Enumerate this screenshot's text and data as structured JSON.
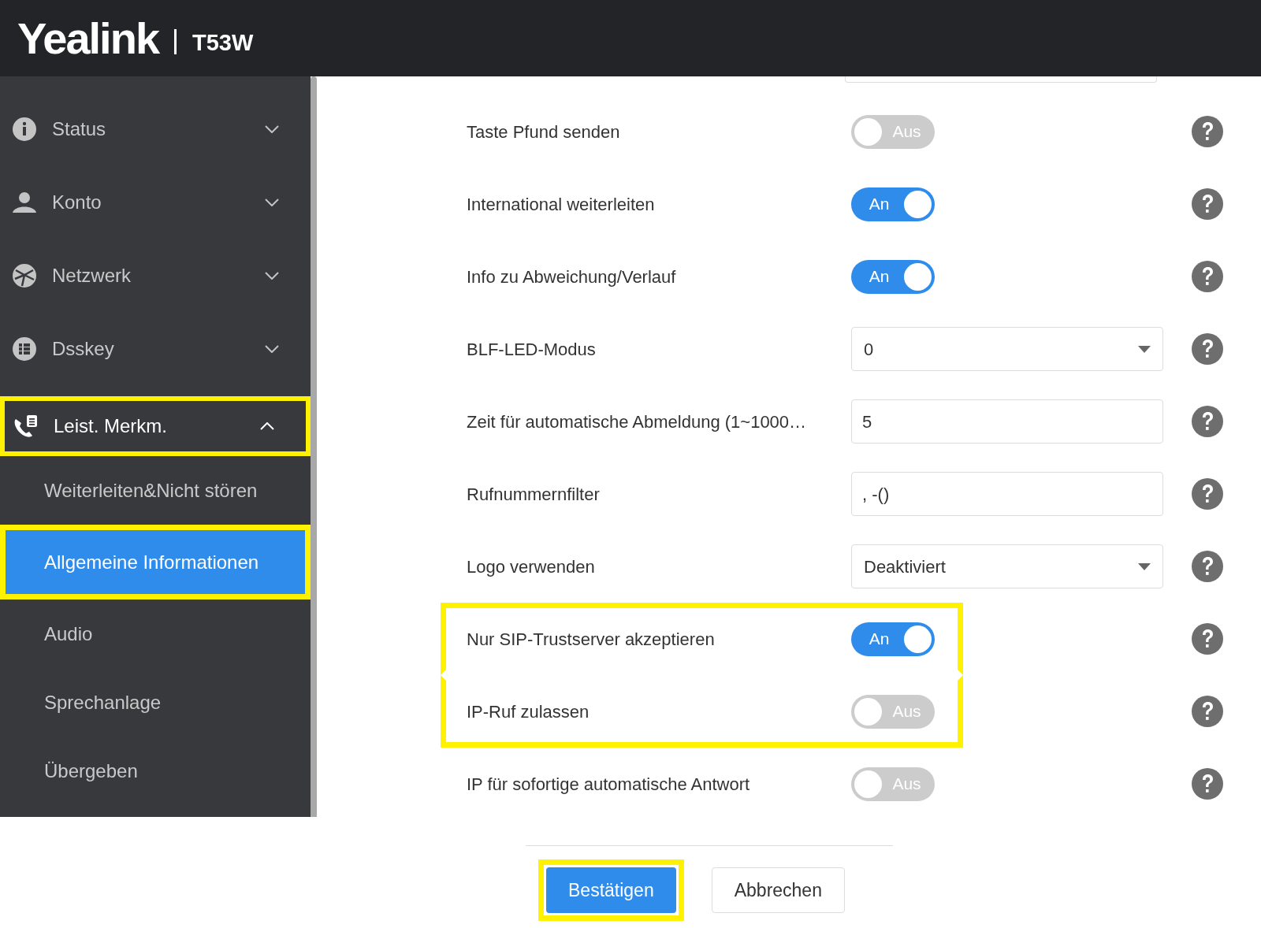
{
  "header": {
    "logo": "Yealink",
    "model": "T53W"
  },
  "sidebar": {
    "items": [
      {
        "label": "Status",
        "expanded": false,
        "highlighted": false
      },
      {
        "label": "Konto",
        "expanded": false,
        "highlighted": false
      },
      {
        "label": "Netzwerk",
        "expanded": false,
        "highlighted": false
      },
      {
        "label": "Dsskey",
        "expanded": false,
        "highlighted": false
      },
      {
        "label": "Leist. Merkm.",
        "expanded": true,
        "highlighted": true,
        "children": [
          {
            "label": "Weiterleiten&Nicht stören",
            "selected": false,
            "highlighted": false
          },
          {
            "label": "Allgemeine Informationen",
            "selected": true,
            "highlighted": true
          },
          {
            "label": "Audio",
            "selected": false,
            "highlighted": false
          },
          {
            "label": "Sprechanlage",
            "selected": false,
            "highlighted": false
          },
          {
            "label": "Übergeben",
            "selected": false,
            "highlighted": false
          }
        ]
      }
    ]
  },
  "settings": [
    {
      "label": "Taste Pfund senden",
      "kind": "toggle",
      "on": false,
      "value": "Aus",
      "highlighted": false
    },
    {
      "label": "International weiterleiten",
      "kind": "toggle",
      "on": true,
      "value": "An",
      "highlighted": false
    },
    {
      "label": "Info zu Abweichung/Verlauf",
      "kind": "toggle",
      "on": true,
      "value": "An",
      "highlighted": false
    },
    {
      "label": "BLF-LED-Modus",
      "kind": "select",
      "value": "0",
      "highlighted": false
    },
    {
      "label": "Zeit für automatische Abmeldung (1~1000…",
      "kind": "text",
      "value": "5",
      "highlighted": false
    },
    {
      "label": "Rufnummernfilter",
      "kind": "text",
      "value": ", -()",
      "highlighted": false
    },
    {
      "label": "Logo verwenden",
      "kind": "select",
      "value": "Deaktiviert",
      "highlighted": false
    },
    {
      "label": "Nur SIP-Trustserver akzeptieren",
      "kind": "toggle",
      "on": true,
      "value": "An",
      "highlighted": true
    },
    {
      "label": "IP-Ruf zulassen",
      "kind": "toggle",
      "on": false,
      "value": "Aus",
      "highlighted": true
    },
    {
      "label": "IP für sofortige automatische Antwort",
      "kind": "toggle",
      "on": false,
      "value": "Aus",
      "highlighted": false
    }
  ],
  "buttons": [
    {
      "label": "Bestätigen",
      "kind": "primary",
      "highlighted": true
    },
    {
      "label": "Abbrechen",
      "kind": "secondary",
      "highlighted": false
    }
  ]
}
